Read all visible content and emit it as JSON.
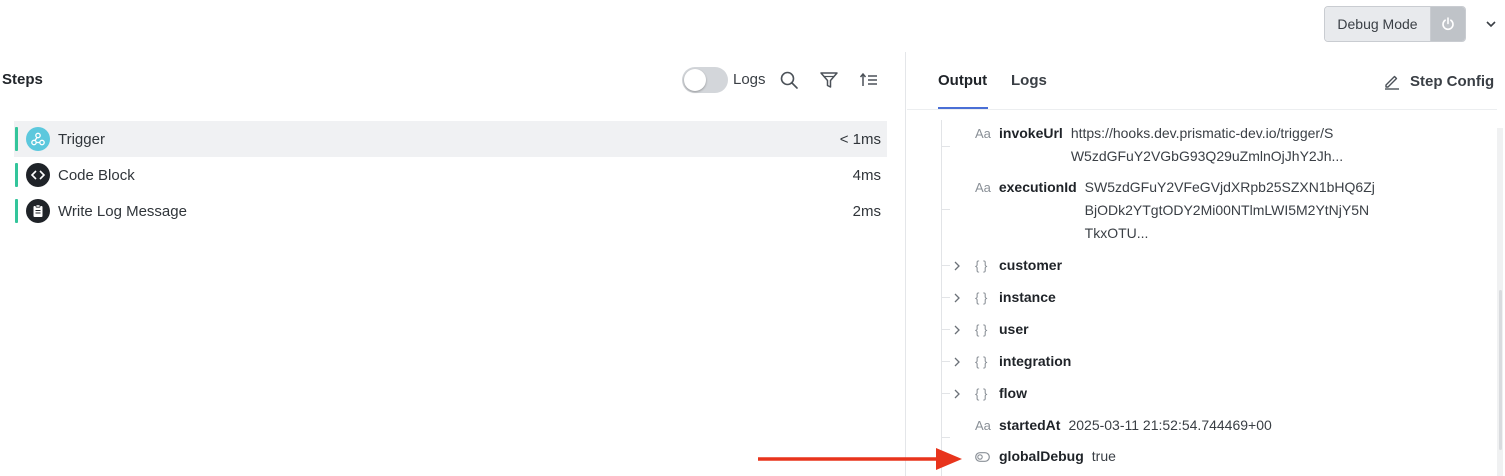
{
  "header": {
    "debug_mode_label": "Debug Mode",
    "power_icon": "power-icon",
    "chevron_icon": "chevron-down-icon"
  },
  "steps_panel": {
    "title": "Steps",
    "logs_toggle_label": "Logs",
    "logs_toggle_on": false,
    "steps": [
      {
        "label": "Trigger",
        "time": "< 1ms",
        "icon": "webhook-icon",
        "selected": true
      },
      {
        "label": "Code Block",
        "time": "4ms",
        "icon": "code-icon",
        "selected": false
      },
      {
        "label": "Write Log Message",
        "time": "2ms",
        "icon": "clipboard-icon",
        "selected": false
      }
    ]
  },
  "output_panel": {
    "tabs": [
      "Output",
      "Logs"
    ],
    "active_tab": "Output",
    "step_config_label": "Step Config",
    "fields": [
      {
        "name": "invokeUrl",
        "type": "text",
        "value": "https://hooks.dev.prismatic-dev.io/trigger/S\nW5zdGFuY2VGbG93Q29uZmlnOjJhY2Jh..."
      },
      {
        "name": "executionId",
        "type": "text",
        "value": "SW5zdGFuY2VFeGVjdXRpb25SZXN1bHQ6Zj\nBjODk2YTgtODY2Mi00NTlmLWI5M2YtNjY5N\nTkxOTU..."
      },
      {
        "name": "customer",
        "type": "object",
        "value": ""
      },
      {
        "name": "instance",
        "type": "object",
        "value": ""
      },
      {
        "name": "user",
        "type": "object",
        "value": ""
      },
      {
        "name": "integration",
        "type": "object",
        "value": ""
      },
      {
        "name": "flow",
        "type": "object",
        "value": ""
      },
      {
        "name": "startedAt",
        "type": "text",
        "value": "2025-03-11 21:52:54.744469+00"
      },
      {
        "name": "globalDebug",
        "type": "boolean",
        "value": "true"
      }
    ]
  },
  "colors": {
    "accent": "#4a6fd6",
    "step_bar": "#33c59b",
    "arrow": "#e8341c"
  }
}
